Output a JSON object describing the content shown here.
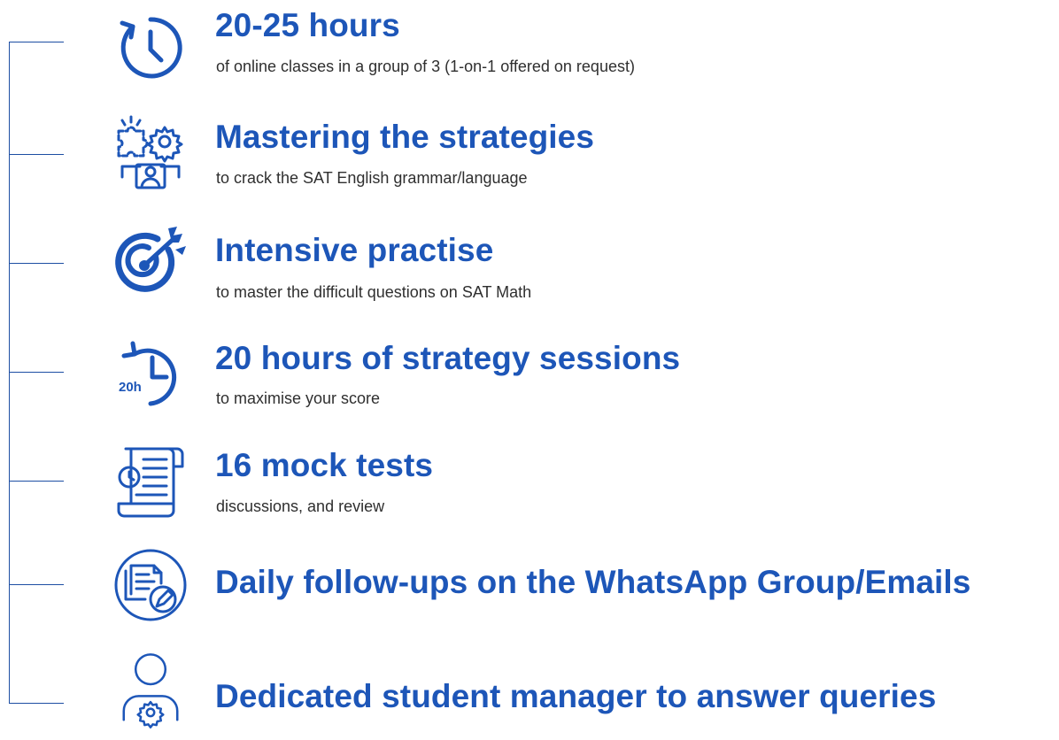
{
  "features": [
    {
      "icon": "clock-icon",
      "title": "20-25 hours",
      "subtitle": "of online classes in a group of 3 (1-on-1 offered on request)"
    },
    {
      "icon": "puzzle-gear-person-icon",
      "title": "Mastering the strategies",
      "subtitle": "to crack the SAT English grammar/language"
    },
    {
      "icon": "target-arrow-icon",
      "title": "Intensive practise",
      "subtitle": "to master the difficult questions on SAT Math"
    },
    {
      "icon": "clock-20h-icon",
      "icon_label": "20h",
      "title": "20 hours of strategy sessions",
      "subtitle": "to maximise your score"
    },
    {
      "icon": "document-clock-icon",
      "title": "16 mock tests",
      "subtitle": "discussions, and review"
    },
    {
      "icon": "document-edit-icon",
      "title": "Daily follow-ups on the WhatsApp Group/Emails"
    },
    {
      "icon": "user-gear-icon",
      "title": "Dedicated student manager to answer queries"
    }
  ],
  "colors": {
    "accent": "#1d56b8",
    "line": "#1d4ea3",
    "subtitle_text": "#2f2f2f"
  }
}
